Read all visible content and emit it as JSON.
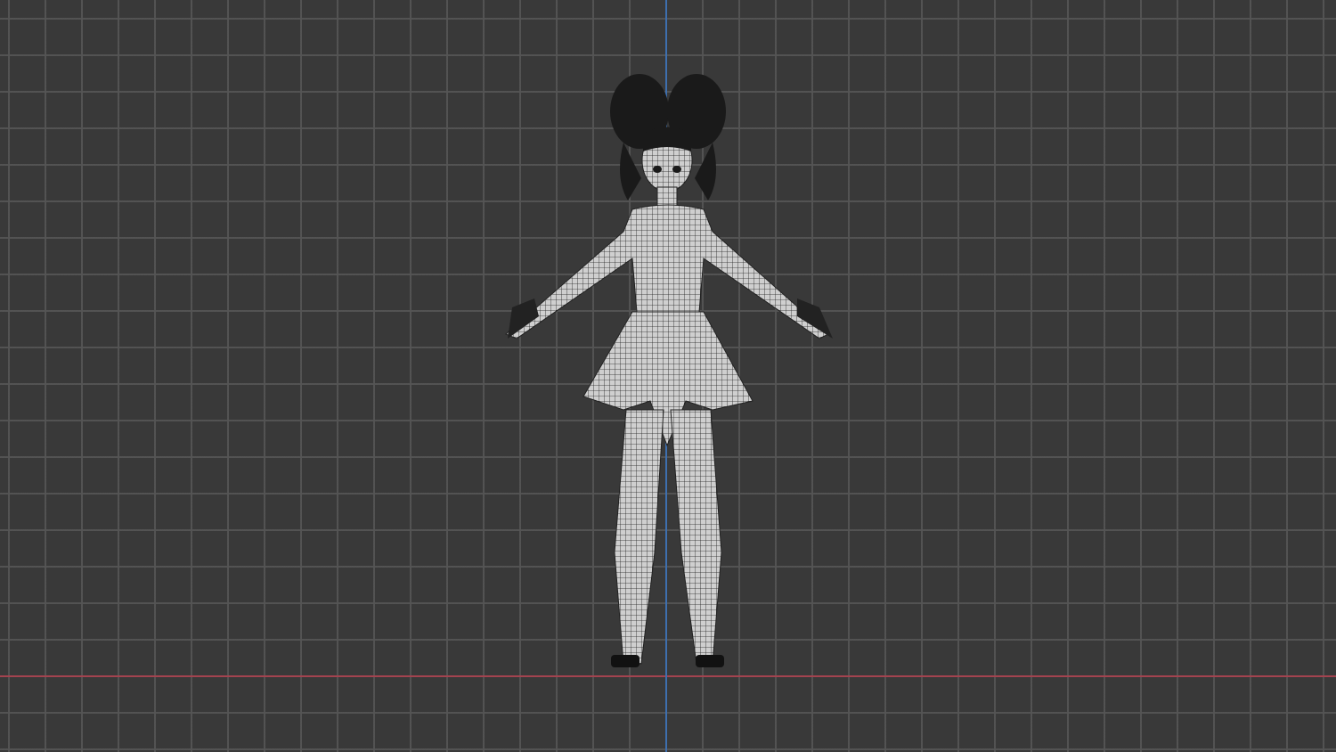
{
  "viewport": {
    "mode": "wireframe",
    "view": "front",
    "colors": {
      "background": "#393939",
      "grid": "#555555",
      "x_axis": "#a3434f",
      "z_axis": "#3e6fae",
      "mesh_fill": "#c8c8c8",
      "wire": "#1a1a1a"
    },
    "object": "character-model"
  }
}
